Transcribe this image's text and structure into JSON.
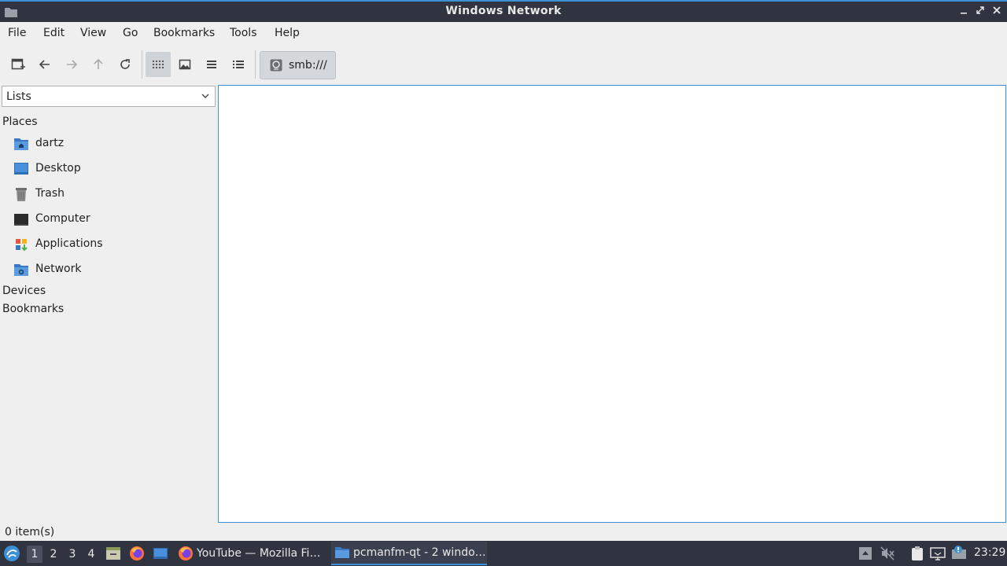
{
  "window": {
    "title": "Windows Network"
  },
  "menubar": {
    "items": [
      "File",
      "Edit",
      "View",
      "Go",
      "Bookmarks",
      "Tools",
      "Help"
    ]
  },
  "toolbar": {
    "path_label": "smb:///",
    "buttons": [
      "new-tab-icon",
      "back-arrow-icon",
      "forward-arrow-icon",
      "up-arrow-icon",
      "reload-icon",
      "icon-view-icon",
      "thumbnail-view-icon",
      "compact-view-icon",
      "detailed-list-view-icon"
    ]
  },
  "side_panel": {
    "mode": "Lists",
    "sections": {
      "places": "Places",
      "devices": "Devices",
      "bookmarks": "Bookmarks"
    },
    "places": [
      {
        "label": "dartz",
        "icon": "home-folder-icon"
      },
      {
        "label": "Desktop",
        "icon": "desktop-icon"
      },
      {
        "label": "Trash",
        "icon": "trash-icon"
      },
      {
        "label": "Computer",
        "icon": "computer-icon"
      },
      {
        "label": "Applications",
        "icon": "applications-icon"
      },
      {
        "label": "Network",
        "icon": "network-folder-icon"
      }
    ]
  },
  "statusbar": {
    "text": "0 item(s)"
  },
  "taskbar": {
    "desktops": [
      "1",
      "2",
      "3",
      "4"
    ],
    "active_desktop": "1",
    "tasks": [
      {
        "label": "YouTube — Mozilla Fi…",
        "icon": "firefox-icon"
      },
      {
        "label": "pcmanfm-qt - 2 windo…",
        "icon": "folder-icon"
      }
    ],
    "clock": "23:29"
  },
  "colors": {
    "accent": "#3d8fd6",
    "titlebar": "#2f3440",
    "panel_bg": "#efefef"
  }
}
